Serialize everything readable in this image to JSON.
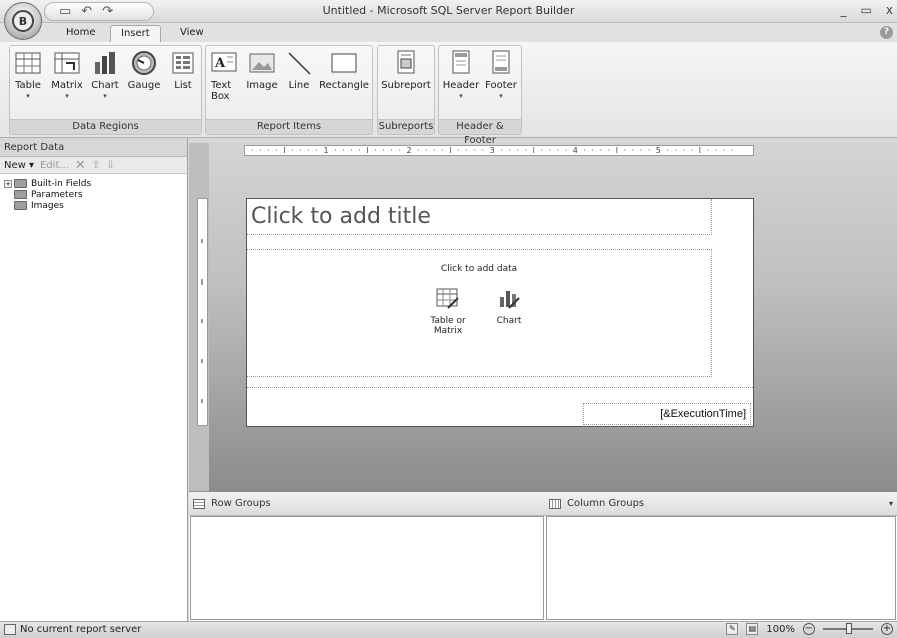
{
  "window": {
    "title": "Untitled - Microsoft SQL Server Report Builder",
    "minimize_glyph": "_",
    "maximize_glyph": "▭",
    "close_glyph": "x"
  },
  "ribbon": {
    "tabs": [
      {
        "label": "Home",
        "active": false
      },
      {
        "label": "Insert",
        "active": true
      },
      {
        "label": "View",
        "active": false
      }
    ],
    "groups": {
      "data_regions": {
        "label": "Data Regions",
        "buttons": [
          "Table",
          "Matrix",
          "Chart",
          "Gauge",
          "List"
        ]
      },
      "report_items": {
        "label": "Report Items",
        "buttons": [
          "Text Box",
          "Image",
          "Line",
          "Rectangle"
        ]
      },
      "subreports": {
        "label": "Subreports",
        "buttons": [
          "Subreport"
        ]
      },
      "header_footer": {
        "label": "Header & Footer",
        "buttons": [
          "Header",
          "Footer"
        ]
      }
    }
  },
  "report_data": {
    "title": "Report Data",
    "toolbar": {
      "new": "New",
      "edit": "Edit..."
    },
    "tree": [
      "Built-in Fields",
      "Parameters",
      "Images"
    ]
  },
  "design_surface": {
    "ruler_text": "· · · · l · · · · 1 · · · · l · · · · 2 · · · · l · · · · 3 · · · · l · · · · 4 · · · · l · · · · 5 · · · · l · · · ·",
    "title_placeholder": "Click to add title",
    "click_to_add_data": "Click to add data",
    "options": [
      "Table or Matrix",
      "Chart"
    ],
    "execution_time": "[&ExecutionTime]"
  },
  "groups_pane": {
    "row_groups": "Row Groups",
    "column_groups": "Column Groups"
  },
  "status_bar": {
    "server_status": "No current report server",
    "zoom": "100%"
  }
}
